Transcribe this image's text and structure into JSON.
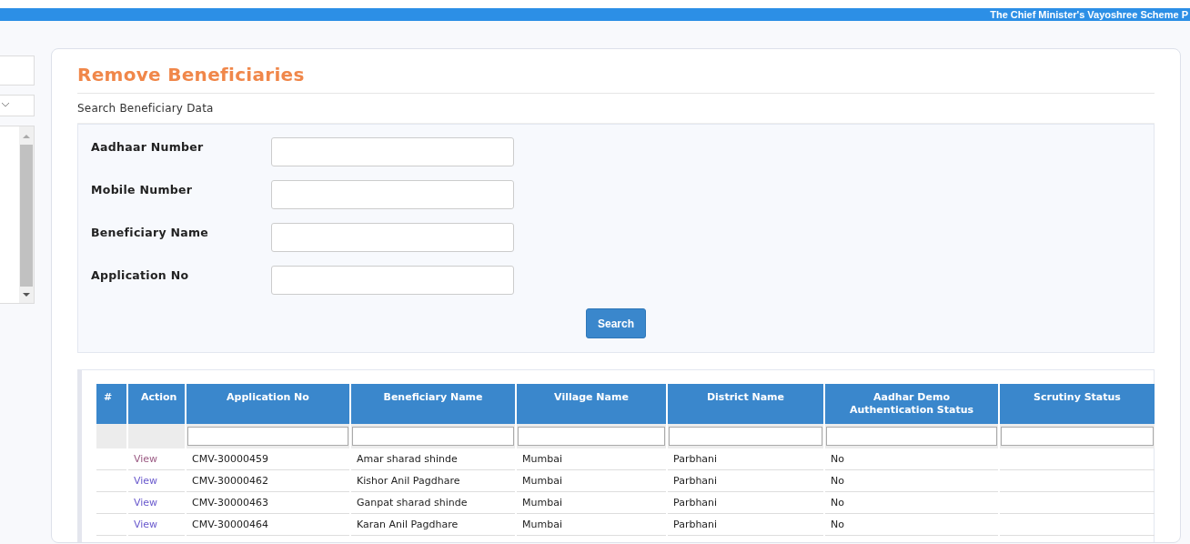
{
  "header": {
    "title": "The Chief Minister's Vayoshree Scheme P"
  },
  "page": {
    "title": "Remove Beneficiaries",
    "subtitle": "Search Beneficiary Data"
  },
  "search_form": {
    "fields": [
      {
        "label": "Aadhaar Number"
      },
      {
        "label": "Mobile Number"
      },
      {
        "label": "Beneficiary Name"
      },
      {
        "label": "Application No"
      }
    ],
    "button": "Search"
  },
  "table": {
    "columns": [
      "#",
      "Action",
      "Application No",
      "Beneficiary Name",
      "Village Name",
      "District Name",
      "Aadhar Demo Authentication Status",
      "Scrutiny Status"
    ],
    "rows": [
      {
        "action": "View",
        "visited": true,
        "application_no": "CMV-30000459",
        "beneficiary_name": "Amar sharad shinde",
        "village_name": "Mumbai",
        "district_name": "Parbhani",
        "aadhar_status": "No"
      },
      {
        "action": "View",
        "visited": false,
        "application_no": "CMV-30000462",
        "beneficiary_name": "Kishor Anil Pagdhare",
        "village_name": "Mumbai",
        "district_name": "Parbhani",
        "aadhar_status": "No"
      },
      {
        "action": "View",
        "visited": false,
        "application_no": "CMV-30000463",
        "beneficiary_name": "Ganpat sharad shinde",
        "village_name": "Mumbai",
        "district_name": "Parbhani",
        "aadhar_status": "No"
      },
      {
        "action": "View",
        "visited": false,
        "application_no": "CMV-30000464",
        "beneficiary_name": "Karan Anil Pagdhare",
        "village_name": "Mumbai",
        "district_name": "Parbhani",
        "aadhar_status": "No"
      }
    ]
  }
}
